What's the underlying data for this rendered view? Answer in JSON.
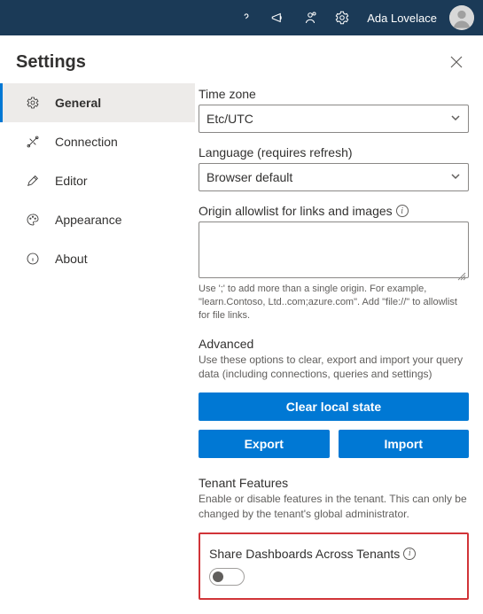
{
  "topbar": {
    "username": "Ada Lovelace"
  },
  "panel": {
    "title": "Settings"
  },
  "sidebar": {
    "items": [
      {
        "label": "General"
      },
      {
        "label": "Connection"
      },
      {
        "label": "Editor"
      },
      {
        "label": "Appearance"
      },
      {
        "label": "About"
      }
    ]
  },
  "main": {
    "timezone_label": "Time zone",
    "timezone_value": "Etc/UTC",
    "language_label": "Language (requires refresh)",
    "language_value": "Browser default",
    "allowlist_label": "Origin allowlist for links and images",
    "allowlist_help": "Use ';' to add more than a single origin. For example, \"learn.Contoso, Ltd..com;azure.com\". Add \"file://\" to allowlist for file links.",
    "advanced_title": "Advanced",
    "advanced_desc": "Use these options to clear, export and import your query data (including connections, queries and settings)",
    "clear_label": "Clear local state",
    "export_label": "Export",
    "import_label": "Import",
    "tenant_title": "Tenant Features",
    "tenant_desc": "Enable or disable features in the tenant. This can only be changed by the tenant's global administrator.",
    "share_label": "Share Dashboards Across Tenants"
  }
}
